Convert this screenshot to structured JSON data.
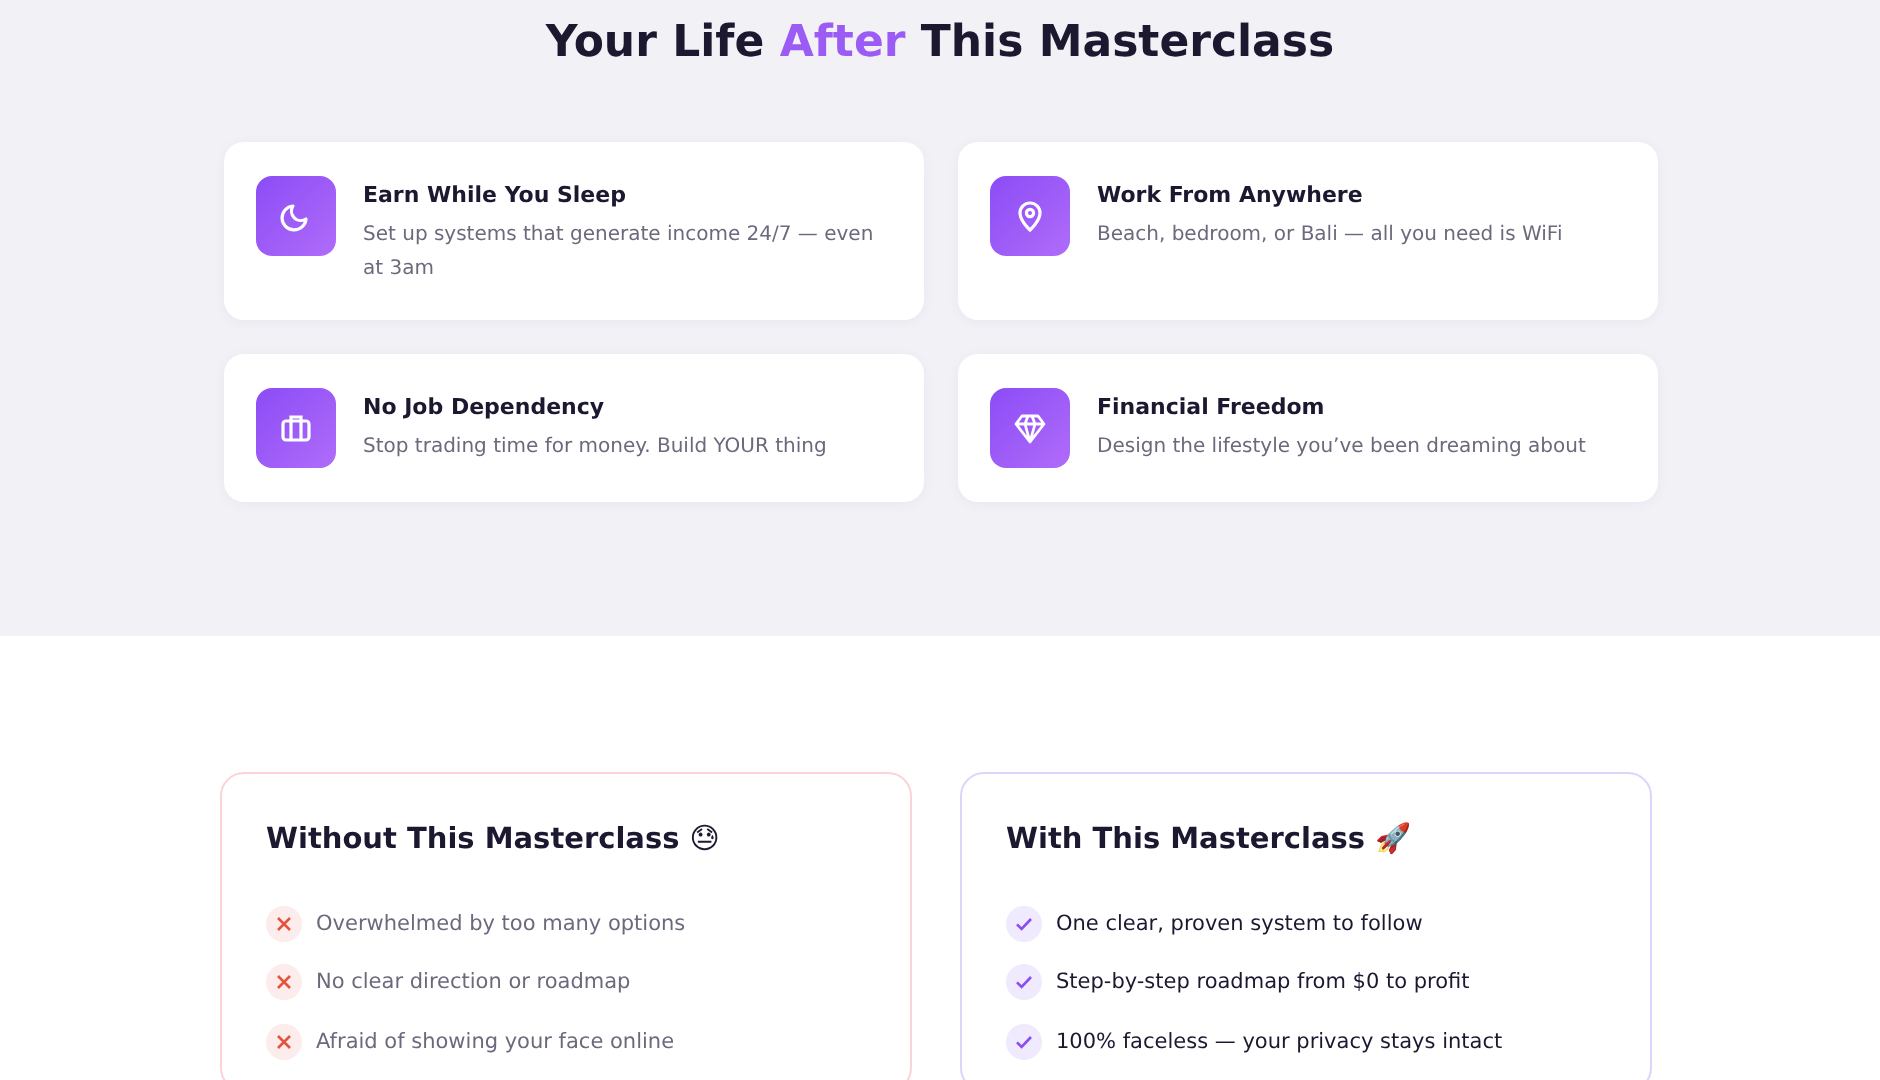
{
  "benefits": {
    "title_parts": [
      {
        "text": "Your Life ",
        "accent": false
      },
      {
        "text": "After",
        "accent": true
      },
      {
        "text": " This Masterclass",
        "accent": false
      }
    ],
    "cards": [
      {
        "kind": "moon",
        "title": "Earn While You Sleep",
        "text": "Set up systems that generate income 24/7 — even at 3am"
      },
      {
        "kind": "pin",
        "title": "Work From Anywhere",
        "text": "Beach, bedroom, or Bali — all you need is WiFi"
      },
      {
        "kind": "briefcase",
        "title": "No Job Dependency",
        "text": "Stop trading time for money. Build YOUR thing"
      },
      {
        "kind": "diamond",
        "title": "Financial Freedom",
        "text": "Design the lifestyle you’ve been dreaming about"
      }
    ]
  },
  "comparison": [
    {
      "kind": "without",
      "title": "Without This Masterclass 😓",
      "items": [
        "Overwhelmed by too many options",
        "No clear direction or roadmap",
        "Afraid of showing your face online"
      ]
    },
    {
      "kind": "with",
      "title": "With This Masterclass 🚀",
      "items": [
        "One clear, proven system to follow",
        "Step-by-step roadmap from $0 to profit",
        "100% faceless — your privacy stays intact"
      ]
    }
  ]
}
